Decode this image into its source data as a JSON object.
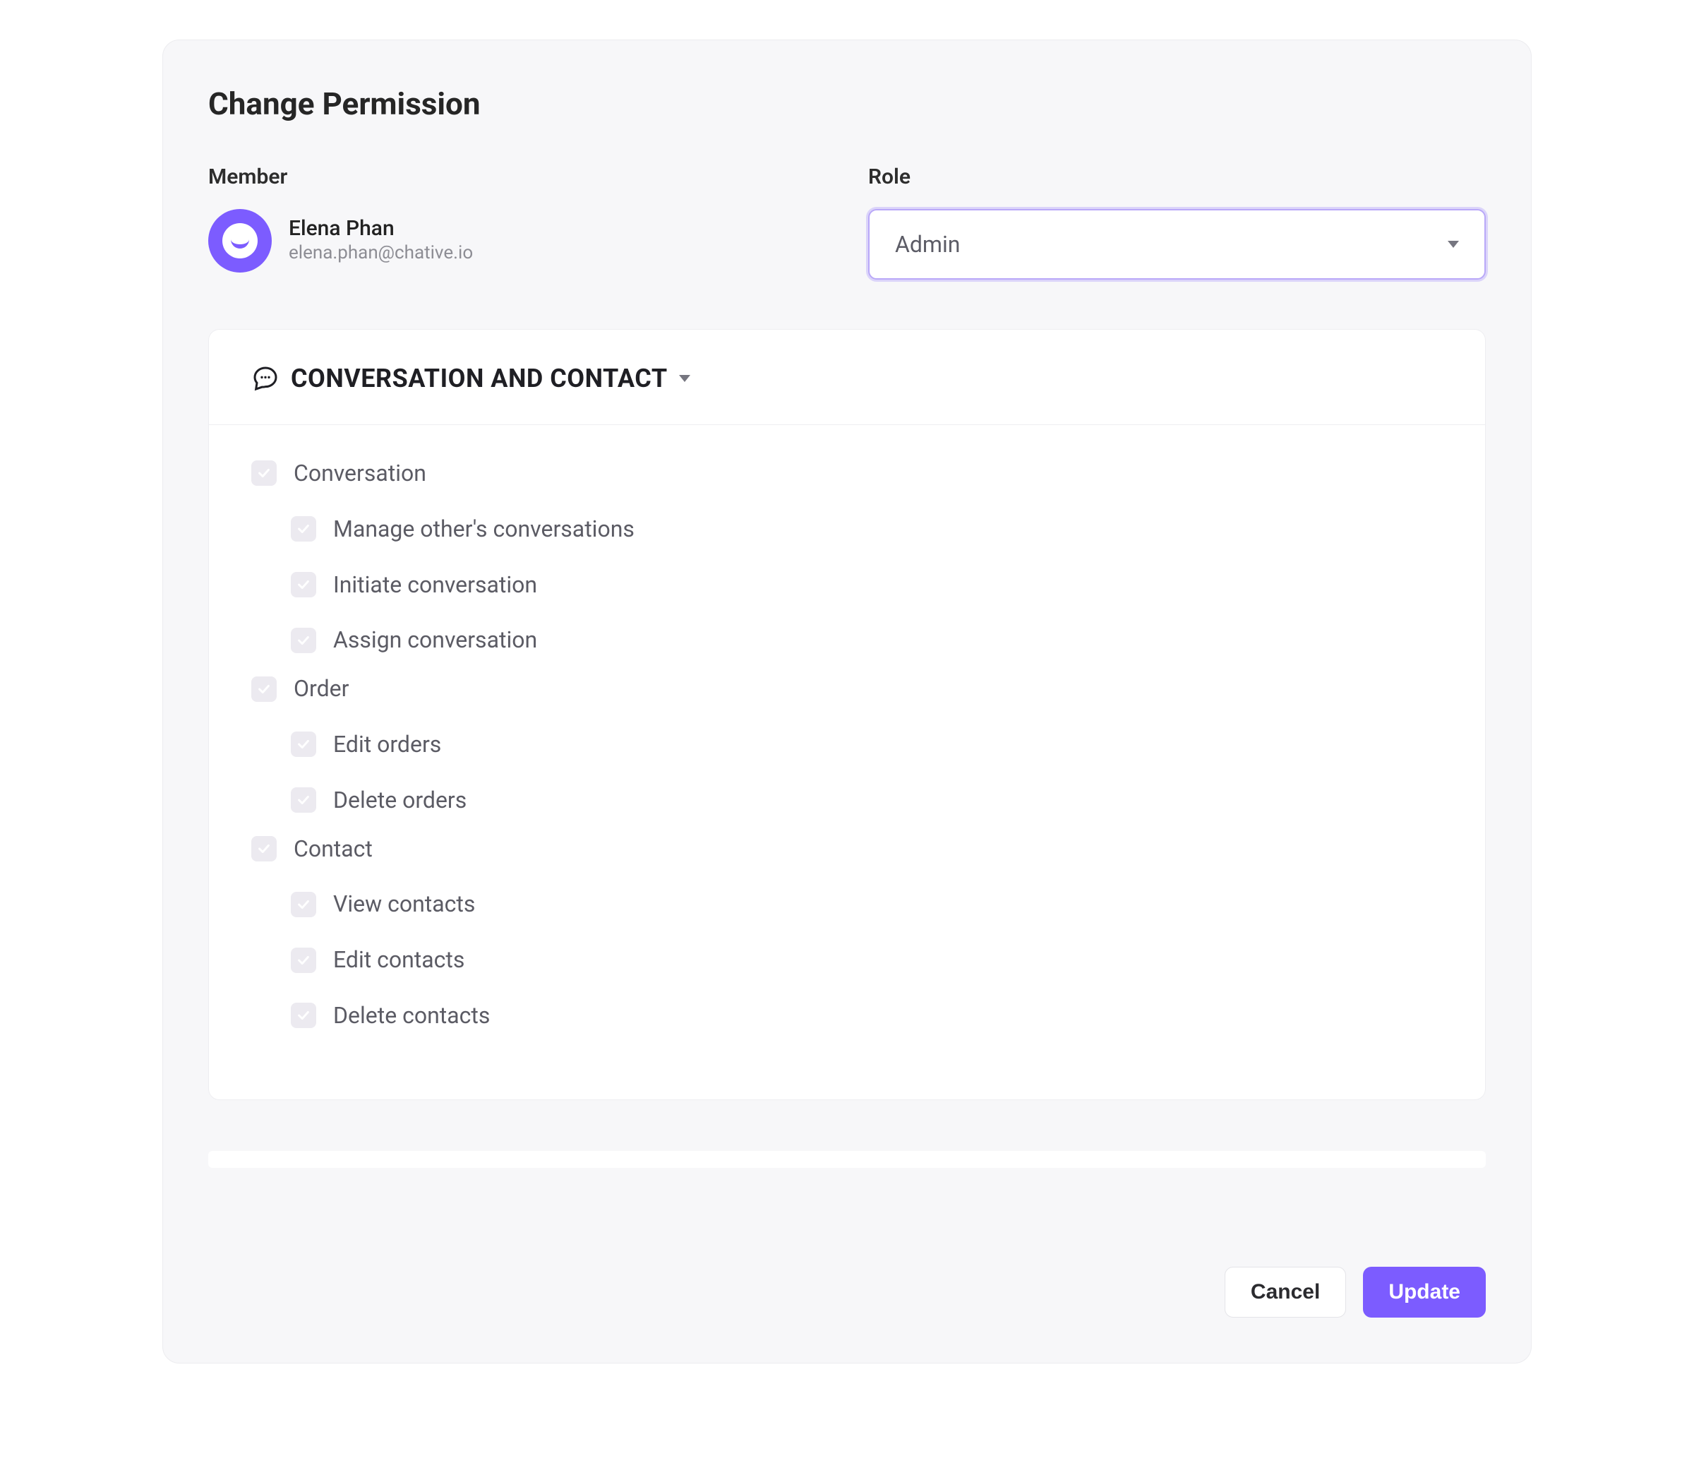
{
  "title": "Change Permission",
  "memberLabel": "Member",
  "roleLabel": "Role",
  "member": {
    "name": "Elena Phan",
    "email": "elena.phan@chative.io"
  },
  "role": {
    "selected": "Admin"
  },
  "section": {
    "title": "CONVERSATION AND CONTACT",
    "groups": [
      {
        "label": "Conversation",
        "items": [
          "Manage other's conversations",
          "Initiate conversation",
          "Assign conversation"
        ]
      },
      {
        "label": "Order",
        "items": [
          "Edit orders",
          "Delete orders"
        ]
      },
      {
        "label": "Contact",
        "items": [
          "View contacts",
          "Edit contacts",
          "Delete contacts"
        ]
      }
    ]
  },
  "footer": {
    "cancel": "Cancel",
    "update": "Update"
  },
  "colors": {
    "accent": "#7c5cff"
  }
}
